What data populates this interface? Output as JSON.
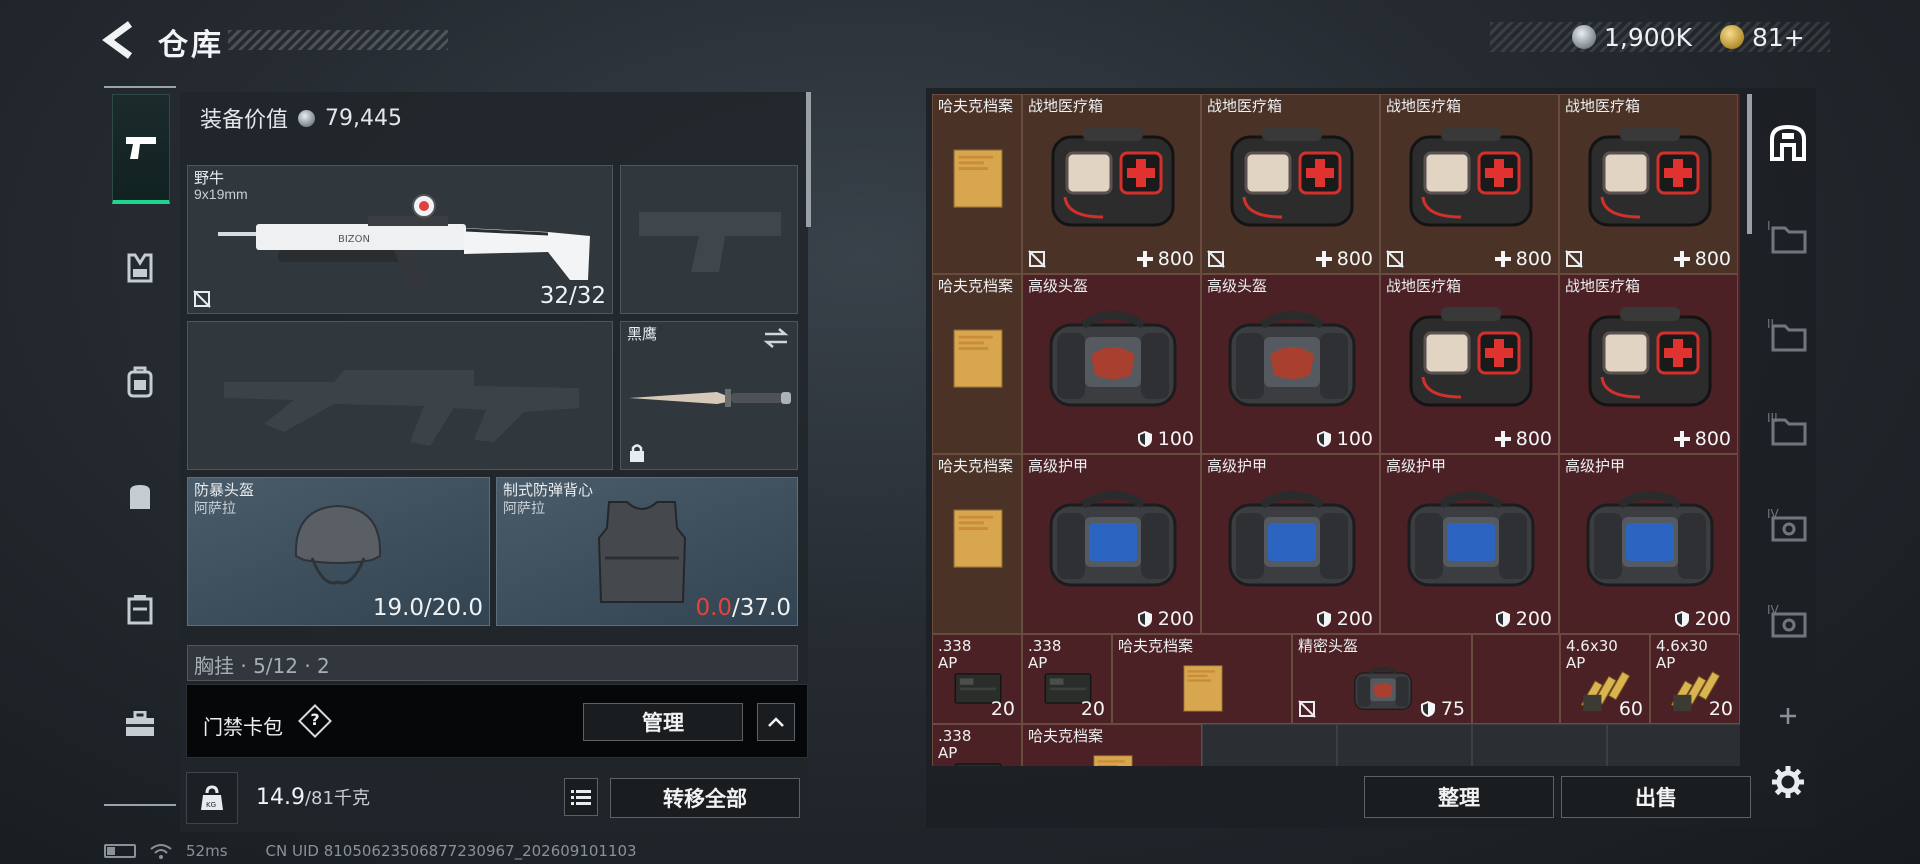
{
  "header": {
    "title": "仓库"
  },
  "currency": {
    "coin_amount": "1,900K",
    "token_amount": "81+"
  },
  "loadout": {
    "value_label": "装备价值",
    "value": "79,445",
    "primary": {
      "name": "野牛",
      "ammo": "9x19mm",
      "count": "32/32"
    },
    "melee": {
      "name": "黑鹰"
    },
    "helmet": {
      "name": "防暴头盔",
      "brand": "阿萨拉",
      "durability": "19.0/20.0"
    },
    "armor": {
      "name": "制式防弹背心",
      "brand": "阿萨拉",
      "durability_current": "0.0",
      "durability_max": "/37.0"
    },
    "chest_rig_label": "胸挂 · 5/12 · 2"
  },
  "keycard": {
    "label": "门禁卡包",
    "help": "?",
    "manage_label": "管理"
  },
  "weight": {
    "current": "14.9",
    "max": "/81千克",
    "transfer_label": "转移全部"
  },
  "stash": {
    "rows": [
      [
        {
          "name": "哈夫克档案",
          "type": "doc"
        },
        {
          "name": "战地医疗箱",
          "type": "med",
          "val": "800"
        },
        {
          "name": "战地医疗箱",
          "type": "med",
          "val": "800"
        },
        {
          "name": "战地医疗箱",
          "type": "med",
          "val": "800"
        },
        {
          "name": "战地医疗箱",
          "type": "med",
          "val": "800"
        }
      ],
      [
        {
          "name": "哈夫克档案",
          "type": "doc"
        },
        {
          "name": "高级头盔",
          "type": "helm",
          "val": "100"
        },
        {
          "name": "高级头盔",
          "type": "helm",
          "val": "100"
        },
        {
          "name": "战地医疗箱",
          "type": "med",
          "val": "800"
        },
        {
          "name": "战地医疗箱",
          "type": "med",
          "val": "800"
        }
      ],
      [
        {
          "name": "哈夫克档案",
          "type": "doc"
        },
        {
          "name": "高级护甲",
          "type": "armor",
          "val": "200"
        },
        {
          "name": "高级护甲",
          "type": "armor",
          "val": "200"
        },
        {
          "name": "高级护甲",
          "type": "armor",
          "val": "200"
        },
        {
          "name": "高级护甲",
          "type": "armor",
          "val": "200"
        }
      ]
    ],
    "row4": [
      {
        "name": ".338",
        "sub": "AP",
        "type": "ammo",
        "val": "20"
      },
      {
        "name": ".338",
        "sub": "AP",
        "type": "ammo",
        "val": "20"
      },
      {
        "name": "哈夫克档案",
        "type": "doc"
      },
      {
        "name": "精密头盔",
        "type": "helm",
        "val": "75"
      },
      {
        "name": "4.6x30",
        "sub": "AP",
        "type": "bullets",
        "val": "60"
      },
      {
        "name": "4.6x30",
        "sub": "AP",
        "type": "bullets",
        "val": "20"
      }
    ],
    "row5": [
      {
        "name": ".338",
        "sub": "AP",
        "type": "ammo"
      },
      {
        "name": "哈夫克档案",
        "type": "doc"
      }
    ],
    "sort_label": "整理",
    "sell_label": "出售"
  },
  "footer": {
    "ping": "52ms",
    "uid": "CN UID 8105062350687723096​7_202609101103"
  },
  "colors": {
    "accent_green": "#1ed48e",
    "stash_red": "#4b2125",
    "stash_brown": "#4a3227",
    "armor_red": "#e0453e"
  }
}
